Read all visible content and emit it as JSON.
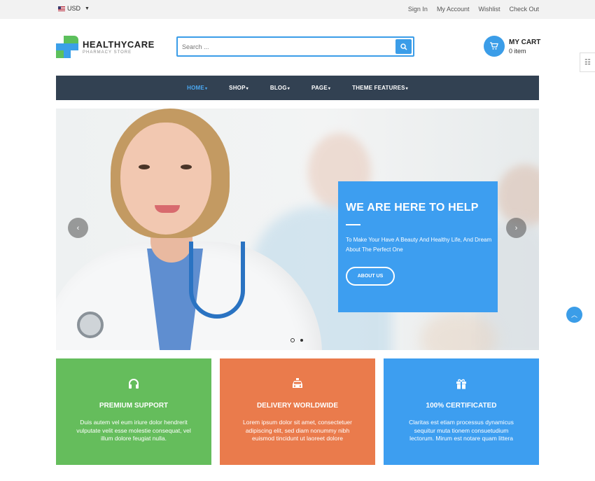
{
  "topbar": {
    "currency": "USD",
    "links": [
      "Sign In",
      "My Account",
      "Wishlist",
      "Check Out"
    ]
  },
  "logo": {
    "name": "HEALTHYCARE",
    "tagline": "PHARMACY STORE"
  },
  "search": {
    "placeholder": "Search ..."
  },
  "cart": {
    "title": "MY CART",
    "count": "0 item"
  },
  "nav": {
    "items": [
      "HOME",
      "SHOP",
      "BLOG",
      "PAGE",
      "THEME FEATURES"
    ],
    "active": "HOME"
  },
  "hero": {
    "title": "WE ARE HERE TO HELP",
    "text": "To Make Your Have A Beauty And Healthy Life, And Dream About The Perfect One",
    "button": "ABOUT US",
    "prev": "‹",
    "next": "›"
  },
  "features": [
    {
      "icon": "headphones-icon",
      "title": "PREMIUM SUPPORT",
      "text": "Duis autem vel eum iriure dolor hendrerit vulputate velit esse molestie consequat, vel illum dolore feugiat nulla.",
      "color": "#65bd5c"
    },
    {
      "icon": "taxi-icon",
      "title": "DELIVERY WORLDWIDE",
      "text": "Lorem ipsum dolor sit amet, consectetuer adipiscing elit, sed diam nonummy nibh euismod tincidunt ut laoreet dolore",
      "color": "#ea7b4c"
    },
    {
      "icon": "gift-icon",
      "title": "100% CERTIFICATED",
      "text": "Claritas est etiam processus dynamicus sequitur muta tionem consuetudium lectorum. Mirum est notare quam littera",
      "color": "#3d9ef0"
    }
  ],
  "colors": {
    "accent": "#3b9de8",
    "nav_bg": "#324152"
  }
}
